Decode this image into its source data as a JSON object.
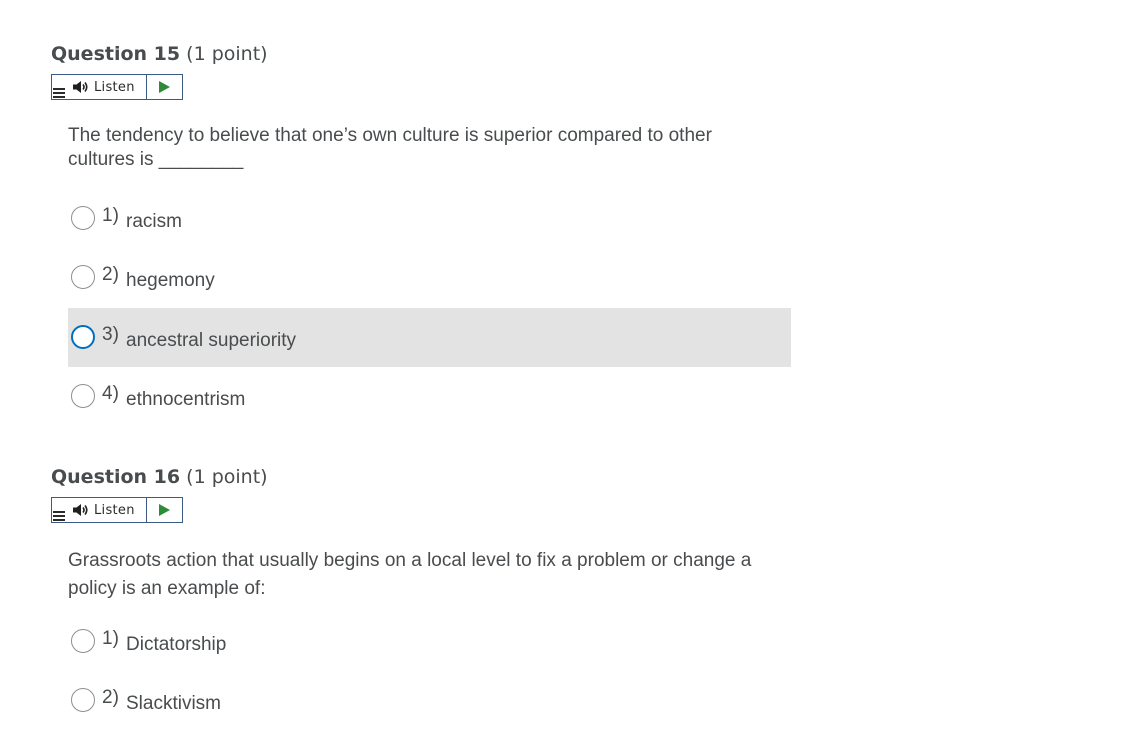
{
  "questions": [
    {
      "number_label": "Question 15",
      "points_label": "(1 point)",
      "listen_label": "Listen",
      "text": "The tendency to believe that one’s own culture is superior compared to other cultures is ________",
      "options": [
        {
          "num": "1)",
          "label": "racism"
        },
        {
          "num": "2)",
          "label": "hegemony"
        },
        {
          "num": "3)",
          "label": "ancestral superiority"
        },
        {
          "num": "4)",
          "label": "ethnocentrism"
        }
      ],
      "highlighted_option": 3
    },
    {
      "number_label": "Question 16",
      "points_label": "(1 point)",
      "listen_label": "Listen",
      "text": "Grassroots action that usually begins on a local level to fix a problem or change a policy is an example of:",
      "options": [
        {
          "num": "1)",
          "label": "Dictatorship"
        },
        {
          "num": "2)",
          "label": "Slacktivism"
        }
      ]
    }
  ],
  "icons": {
    "speaker": "speaker-icon",
    "play": "play-icon",
    "menu": "menu-icon"
  },
  "colors": {
    "text": "#494c4e",
    "listen_border": "#3b5a85",
    "play_green": "#2e8b3a",
    "focus_blue": "#006fbf",
    "highlight_bg": "#e3e3e3"
  }
}
